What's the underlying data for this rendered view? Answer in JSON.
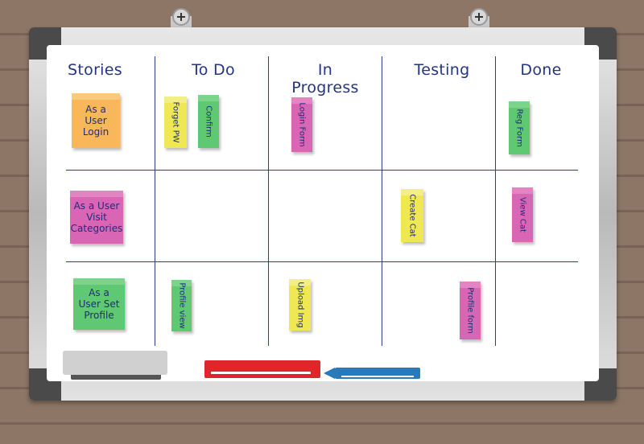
{
  "board": {
    "columns": [
      "Stories",
      "To Do",
      "In Progress",
      "Testing",
      "Done"
    ],
    "stories": [
      {
        "text": "As a User Login",
        "color": "#f7b75a"
      },
      {
        "text": "As a User Visit Categories",
        "color": "#d966b4"
      },
      {
        "text": "As a User Set Profile",
        "color": "#5fc872"
      }
    ],
    "tasks": [
      {
        "text": "Forget PW",
        "color": "#f0e852"
      },
      {
        "text": "Confirm",
        "color": "#5fc872"
      },
      {
        "text": "Login Form",
        "color": "#d966b4"
      },
      {
        "text": "Reg Form",
        "color": "#5fc872"
      },
      {
        "text": "Create Cat",
        "color": "#f0e852"
      },
      {
        "text": "View Cat",
        "color": "#d966b4"
      },
      {
        "text": "Profile view",
        "color": "#5fc872"
      },
      {
        "text": "Upload Img",
        "color": "#f0e852"
      },
      {
        "text": "Profile form",
        "color": "#d966b4"
      }
    ]
  }
}
